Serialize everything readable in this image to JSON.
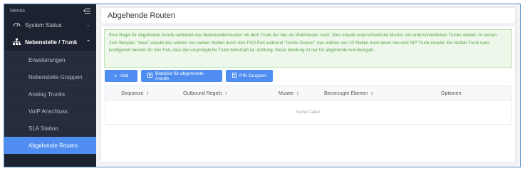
{
  "sidebar": {
    "header_label": "Menüs",
    "system_status": "System Status",
    "section_title": "Nebenstelle / Trunk",
    "items": [
      {
        "label": "Erweiterungen",
        "active": false
      },
      {
        "label": "Nebenstelle Gruppen",
        "active": false
      },
      {
        "label": "Analog Trunks",
        "active": false
      },
      {
        "label": "VoIP Anschluss",
        "active": false
      },
      {
        "label": "SLA Station",
        "active": false
      },
      {
        "label": "Abgehende Routen",
        "active": true
      }
    ]
  },
  "page": {
    "title": "Abgehende Routen"
  },
  "notice": {
    "text": "Eine Regel für abgehende Anrufe verbindet das Nebenstellenmuster mit dem Trunk der das als Wahlmuster nutzt. Dies erlaubt unterschiedliche Muster von unterschiedlichen Trunks wählen zu lassen. Zum Beispiel, \"lokal\" erlaubt das wählen von sieben Stellen durch den FXO Port während \"Große Distanz\" das wählen von 10 Stellen duch einen low-cost SIP Trunk erlaubt. Ein Notfall-Trunk kann konfiguriert werden für den Fall, dass der ursprüngliche Trunk fehlerhaft ist. Achtung: Diese Meldung ist nur für abgehende Anruferegeln."
  },
  "toolbar": {
    "add_label": "Add",
    "blacklist_label": "Blacklist für abgehende Anrufe",
    "pin_label": "PIN Gruppen"
  },
  "table": {
    "columns": [
      "Sequenze",
      "Outbound Regeln",
      "Muster",
      "Bevorzugte Ebenen",
      "Optionen"
    ],
    "empty_text": "Keine Daten"
  },
  "colors": {
    "sidebar_bg": "#1d2230",
    "accent": "#4f8ef0",
    "notice_text": "#59a34a"
  }
}
